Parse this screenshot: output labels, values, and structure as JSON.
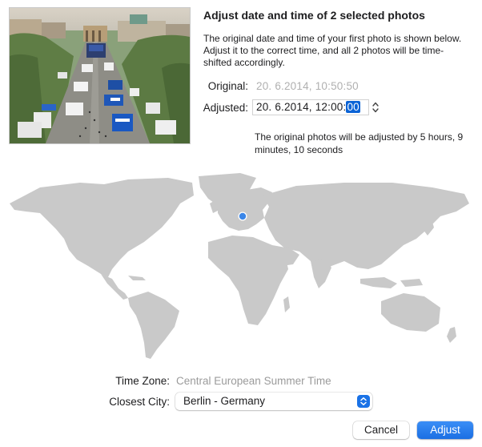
{
  "dialog": {
    "title": "Adjust date and time of 2 selected photos",
    "description": "The original date and time of your first photo is shown below. Adjust it to the correct time, and all 2 photos will be time-shifted accordingly."
  },
  "original": {
    "label": "Original:",
    "value": "20.  6.2014, 10:50:50"
  },
  "adjusted": {
    "label": "Adjusted:",
    "value_prefix": "20.  6.2014, 12:00:",
    "selected_segment": "00"
  },
  "shift_note": "The original photos will be adjusted by 5 hours, 9 minutes, 10 seconds",
  "time_zone": {
    "label": "Time Zone:",
    "value": "Central European Summer Time"
  },
  "closest_city": {
    "label": "Closest City:",
    "selected": "Berlin - Germany"
  },
  "buttons": {
    "cancel": "Cancel",
    "adjust": "Adjust"
  },
  "colors": {
    "accent": "#1a72e6",
    "map_land": "#c9c9c9",
    "location_pin": "#3a86e8"
  },
  "icons": {
    "stepper": "up-down-chevron-icon",
    "popup": "popup-chevron-icon",
    "pin": "location-pin-icon"
  }
}
